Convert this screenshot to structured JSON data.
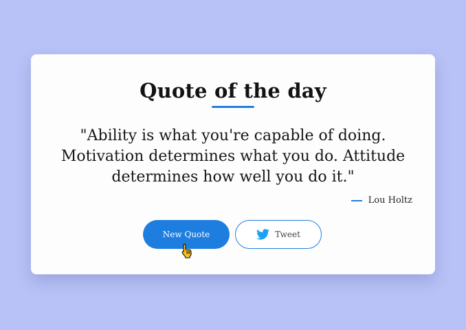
{
  "card": {
    "title": "Quote of the day",
    "quote": "\"Ability is what you're capable of doing. Motivation determines what you do. Attitude determines how well you do it.\"",
    "author": "Lou Holtz"
  },
  "buttons": {
    "new_quote_label": "New Quote",
    "tweet_label": "Tweet",
    "tweet_icon": "twitter-icon"
  },
  "cursor": "hand-pointer-icon",
  "colors": {
    "background": "#b8c2f6",
    "card": "#fdfdfe",
    "accent": "#1e7ee0",
    "twitter": "#1da1f2"
  }
}
